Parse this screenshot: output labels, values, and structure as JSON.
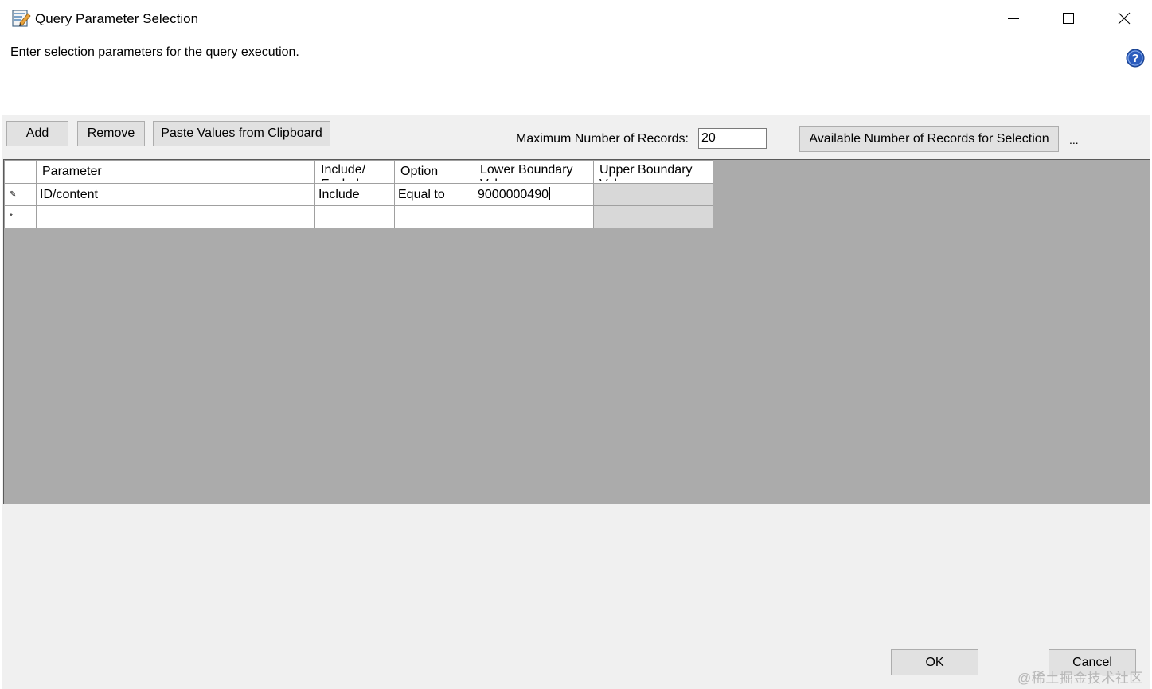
{
  "window": {
    "title": "Query Parameter Selection",
    "instruction": "Enter selection parameters for the query execution."
  },
  "toolbar": {
    "add_label": "Add",
    "remove_label": "Remove",
    "paste_label": "Paste Values from Clipboard",
    "max_records_label": "Maximum Number of Records:",
    "max_records_value": "20",
    "available_label": "Available Number of Records for Selection",
    "ellipsis": "..."
  },
  "grid": {
    "columns": [
      "Parameter",
      "Include/\nExclude",
      "Option",
      "Lower Boundary\nValue",
      "Upper Boundary\nValue"
    ],
    "rows": [
      {
        "marker": "✎",
        "parameter": "ID/content",
        "include": "Include",
        "option": "Equal to",
        "lower": "9000000490",
        "upper": ""
      },
      {
        "marker": "*",
        "parameter": "",
        "include": "",
        "option": "",
        "lower": "",
        "upper": ""
      }
    ]
  },
  "footer": {
    "ok_label": "OK",
    "cancel_label": "Cancel"
  },
  "watermark": "@稀土掘金技术社区",
  "icons": {
    "app": "query-parameter-icon",
    "help": "help-icon",
    "minimize": "minimize-icon",
    "maximize": "maximize-icon",
    "close": "close-icon"
  },
  "colors": {
    "grid_background": "#ababab",
    "help_blue": "#2a5bbd"
  }
}
